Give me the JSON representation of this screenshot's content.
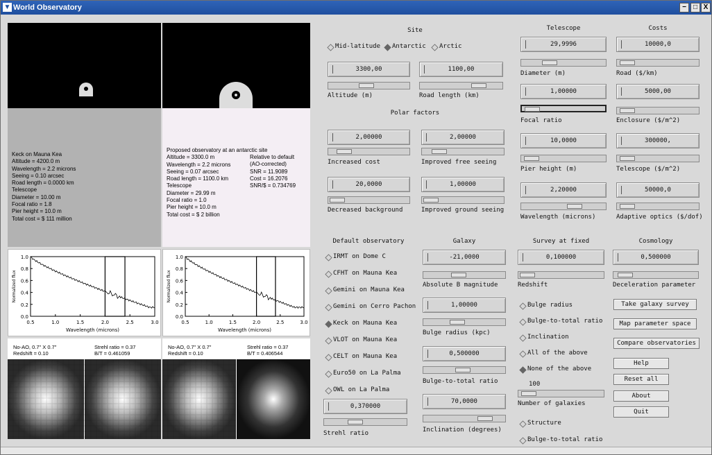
{
  "window": {
    "title": "World Observatory",
    "min": "−",
    "max": "□",
    "close": "X"
  },
  "left": {
    "keck": {
      "lines": [
        "Keck on Mauna Kea",
        "Altitude = 4200.0 m",
        "Wavelength = 2.2 microns",
        "Seeing = 0.10 arcsec",
        "Road length = 0.0000 km",
        "Telescope",
        "Diameter = 10.00 m",
        "Focal ratio = 1.8",
        "Pier height = 10.0 m",
        "Total cost = $ 111 million"
      ]
    },
    "prop": {
      "lines": [
        "Proposed observatory at an antarctic site",
        "Altitude = 3300.0 m",
        "Wavelength = 2.2 microns",
        "Seeing = 0.07 arcsec",
        "Road length = 1100.0 km",
        "Telescope",
        "Diameter = 29.99 m",
        "Focal ratio = 1.0",
        "Pier height = 10.0 m",
        "Total cost = $ 2 billion"
      ],
      "rel": [
        "Relative to default",
        "(AO-corrected)",
        "SNR = 11.9089",
        "Cost = 16.2076",
        "SNR/$ = 0.734769"
      ]
    },
    "plot_xlabel": "Wavelength (microns)",
    "plot_ylabel": "Normalized flux",
    "xticks": [
      "0.5",
      "1.0",
      "1.5",
      "2.0",
      "2.5",
      "3.0"
    ],
    "yticks": [
      "1.0",
      "0.8",
      "0.6",
      "0.4",
      "0.2",
      "0.0"
    ],
    "keck_img": {
      "l1": "No-AO, 0.7\" X 0.7\"",
      "l2": "Redshift = 0.10",
      "r1": "Strehl ratio = 0.37",
      "r2": "B/T = 0.461059"
    },
    "prop_img": {
      "l1": "No-AO, 0.7\" X 0.7\"",
      "l2": "Redshift = 0.10",
      "r1": "Strehl ratio = 0.37",
      "r2": "B/T = 0.406544"
    }
  },
  "site": {
    "header": "Site",
    "radios": [
      "Mid-latitude",
      "Antarctic",
      "Arctic"
    ],
    "altitude": {
      "value": "3300,00",
      "label": "Altitude (m)"
    },
    "road": {
      "value": "1100,00",
      "label": "Road length (km)"
    }
  },
  "polar": {
    "header": "Polar factors",
    "increased_cost": {
      "value": "2,00000",
      "label": "Increased cost"
    },
    "free_seeing": {
      "value": "2,00000",
      "label": "Improved free seeing"
    },
    "background": {
      "value": "20,0000",
      "label": "Decreased background"
    },
    "ground_seeing": {
      "value": "1,00000",
      "label": "Improved ground seeing"
    }
  },
  "telescope": {
    "header": "Telescope",
    "diameter": {
      "value": "29,9996",
      "label": "Diameter (m)"
    },
    "focal": {
      "value": "1,00000",
      "label": "Focal ratio"
    },
    "pier": {
      "value": "10,0000",
      "label": "Pier height (m)"
    },
    "wave": {
      "value": "2,20000",
      "label": "Wavelength (microns)"
    }
  },
  "costs": {
    "header": "Costs",
    "road": {
      "value": "10000,0",
      "label": "Road ($/km)"
    },
    "enclosure": {
      "value": "5000,00",
      "label": "Enclosure ($/m^2)"
    },
    "tel": {
      "value": "300000,",
      "label": "Telescope ($/m^2)"
    },
    "ao": {
      "value": "50000,0",
      "label": "Adaptive optics ($/dof)"
    }
  },
  "default_obs": {
    "header": "Default observatory",
    "items": [
      "IRMT on Dome C",
      "CFHT on Mauna Kea",
      "Gemini on Mauna Kea",
      "Gemini on Cerro Pachon",
      "Keck on Mauna Kea",
      "VLOT on Mauna Kea",
      "CELT on Mauna Kea",
      "Euro50 on La Palma",
      "OWL on La Palma"
    ],
    "strehl": {
      "value": "0,370000",
      "label": "Strehl ratio"
    }
  },
  "galaxy": {
    "header": "Galaxy",
    "absb": {
      "value": "-21,0000",
      "label": "Absolute B magnitude"
    },
    "bulge": {
      "value": "1,00000",
      "label": "Bulge radius (kpc)"
    },
    "bt": {
      "value": "0,500000",
      "label": "Bulge-to-total ratio"
    },
    "incl": {
      "value": "70,0000",
      "label": "Inclination (degrees)"
    }
  },
  "survey": {
    "header": "Survey at fixed",
    "redshift": {
      "value": "0,100000",
      "label": "Redshift"
    },
    "radios": [
      "Bulge radius",
      "Bulge-to-total ratio",
      "Inclination",
      "All of the above",
      "None of the above"
    ],
    "num_value": "100",
    "num_label": "Number of galaxies",
    "radios2": [
      "Structure",
      "Bulge-to-total ratio"
    ]
  },
  "cosmology": {
    "header": "Cosmology",
    "decel": {
      "value": "0,500000",
      "label": "Deceleration parameter"
    }
  },
  "buttons": [
    "Take galaxy survey",
    "Map parameter space",
    "Compare observatories",
    "Help",
    "Reset all",
    "About",
    "Quit"
  ]
}
